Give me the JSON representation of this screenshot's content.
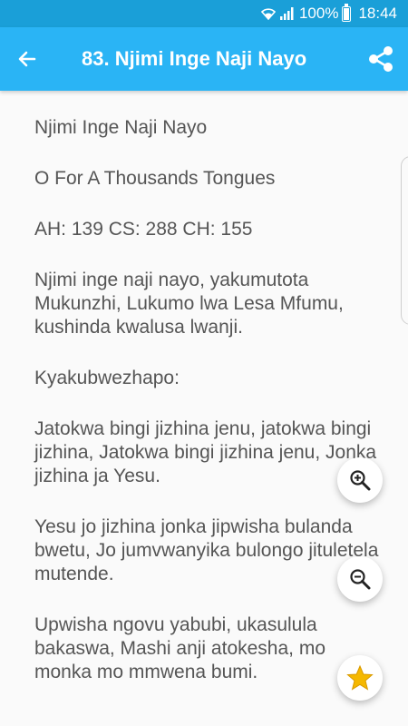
{
  "status_bar": {
    "battery_percent": "100%",
    "time": "18:44",
    "icons": [
      "wifi-icon",
      "signal-icon",
      "battery-icon"
    ]
  },
  "app_bar": {
    "title": "83. Njimi Inge Naji Nayo",
    "back_icon": "arrow-left-icon",
    "share_icon": "share-icon",
    "color": "#2ab4f5"
  },
  "hymn": {
    "title": "Njimi Inge Naji Nayo",
    "english_title": "O For A Thousands Tongues",
    "references": "AH: 139 CS: 288 CH: 155",
    "verse_1": "Njimi inge naji nayo, yakumutota Mukunzhi, Lukumo lwa Lesa Mfumu, kushinda kwalusa lwanji.",
    "chorus_label": "Kyakubwezhapo:",
    "chorus": "Jatokwa bingi jizhina jenu, jatokwa bingi jizhina, Jatokwa bingi jizhina jenu, Jonka jizhina ja Yesu.",
    "verse_2": "Yesu jo jizhina jonka jipwisha bulanda bwetu, Jo jumvwanyika bulongo jituletela mutende.",
    "verse_3": "Upwisha ngovu yabubi, ukasulula bakaswa, Mashi anji atokesha, mo monka mo mmwena bumi."
  },
  "fabs": {
    "zoom_in": "zoom-in-icon",
    "zoom_out": "zoom-out-icon",
    "favorite": "star-icon",
    "star_color": "#f5b800"
  }
}
